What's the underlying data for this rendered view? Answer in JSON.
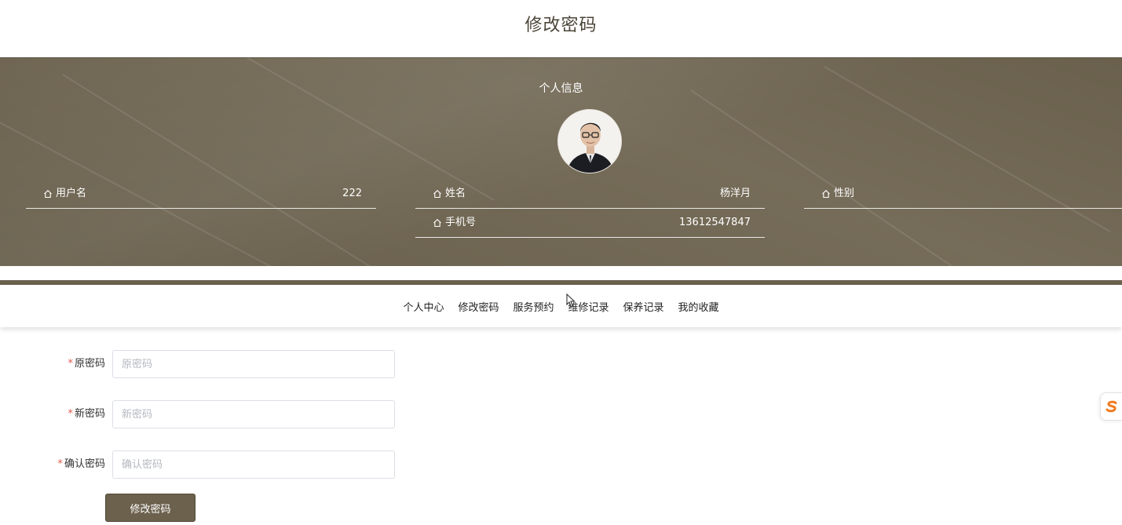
{
  "page": {
    "title": "修改密码"
  },
  "profile": {
    "section_title": "个人信息",
    "fields": [
      {
        "label": "用户名",
        "value": "222"
      },
      {
        "label": "姓名",
        "value": "杨洋月"
      },
      {
        "label": "性别",
        "value": ""
      },
      {
        "label": "手机号",
        "value": "13612547847"
      }
    ]
  },
  "nav": {
    "items": [
      {
        "label": "个人中心"
      },
      {
        "label": "修改密码"
      },
      {
        "label": "服务预约"
      },
      {
        "label": "维修记录"
      },
      {
        "label": "保养记录"
      },
      {
        "label": "我的收藏"
      }
    ]
  },
  "form": {
    "old_password": {
      "label": "原密码",
      "placeholder": "原密码",
      "value": ""
    },
    "new_password": {
      "label": "新密码",
      "placeholder": "新密码",
      "value": ""
    },
    "confirm_password": {
      "label": "确认密码",
      "placeholder": "确认密码",
      "value": ""
    },
    "required_mark": "*",
    "submit_label": "修改密码"
  },
  "theme": {
    "primary": "#6b614d",
    "required": "#e15a4a"
  },
  "icons": {
    "field": "home-icon",
    "float": "s-logo-icon"
  }
}
